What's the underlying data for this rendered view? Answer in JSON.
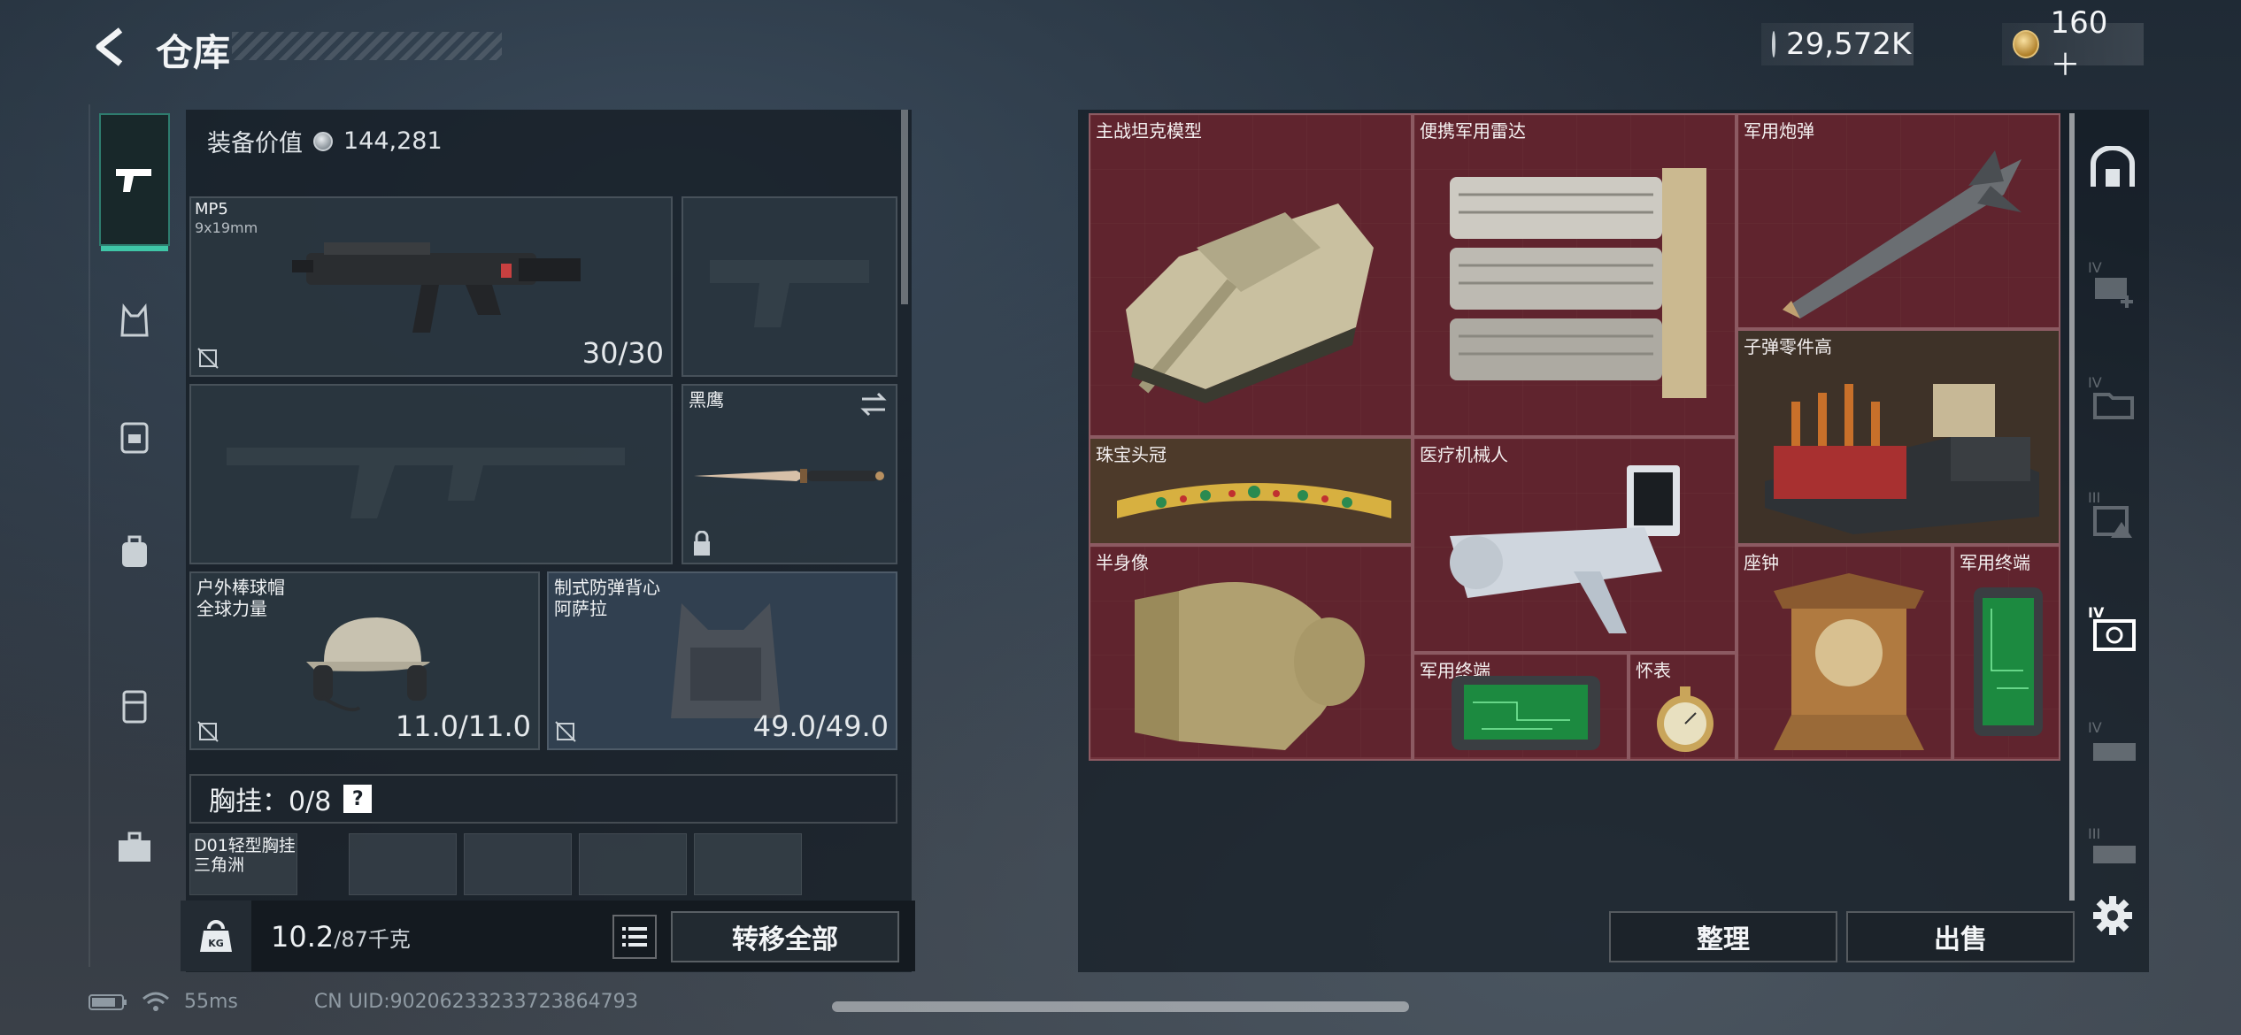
{
  "header": {
    "title": "仓库",
    "silver_amount": "29,572K",
    "gold_amount": "160＋"
  },
  "equipment": {
    "value_label": "装备价值",
    "value": "144,281",
    "primary_weapon": {
      "name": "MP5",
      "caliber": "9x19mm",
      "ammo": "30/30"
    },
    "melee": {
      "name": "黑鹰"
    },
    "helmet": {
      "name": "户外棒球帽",
      "sub": "全球力量",
      "durability": "11.0/11.0"
    },
    "armor": {
      "name": "制式防弹背心",
      "sub": "阿萨拉",
      "durability": "49.0/49.0"
    },
    "chest_rig_label": "胸挂：0/8",
    "chest_help": "?",
    "chest_rig_item": {
      "name": "D01轻型胸挂",
      "sub": "三角洲"
    }
  },
  "weight": {
    "current": "10.2",
    "max": "/87千克"
  },
  "buttons": {
    "transfer_all": "转移全部",
    "sort": "整理",
    "sell": "出售"
  },
  "container_items": [
    {
      "name": "主战坦克模型"
    },
    {
      "name": "便携军用雷达"
    },
    {
      "name": "军用炮弹"
    },
    {
      "name": "子弹零件高"
    },
    {
      "name": "珠宝头冠"
    },
    {
      "name": "医疗机械人"
    },
    {
      "name": "半身像"
    },
    {
      "name": "军用终端"
    },
    {
      "name": "怀表"
    },
    {
      "name": "座钟"
    },
    {
      "name": "军用终端"
    }
  ],
  "status": {
    "ping": "55ms",
    "uid": "CN UID:9020623323372386479З"
  },
  "icons": {
    "back": "back-arrow-icon",
    "settings": "gear-icon",
    "weight": "kettlebell-icon",
    "list": "list-icon"
  }
}
